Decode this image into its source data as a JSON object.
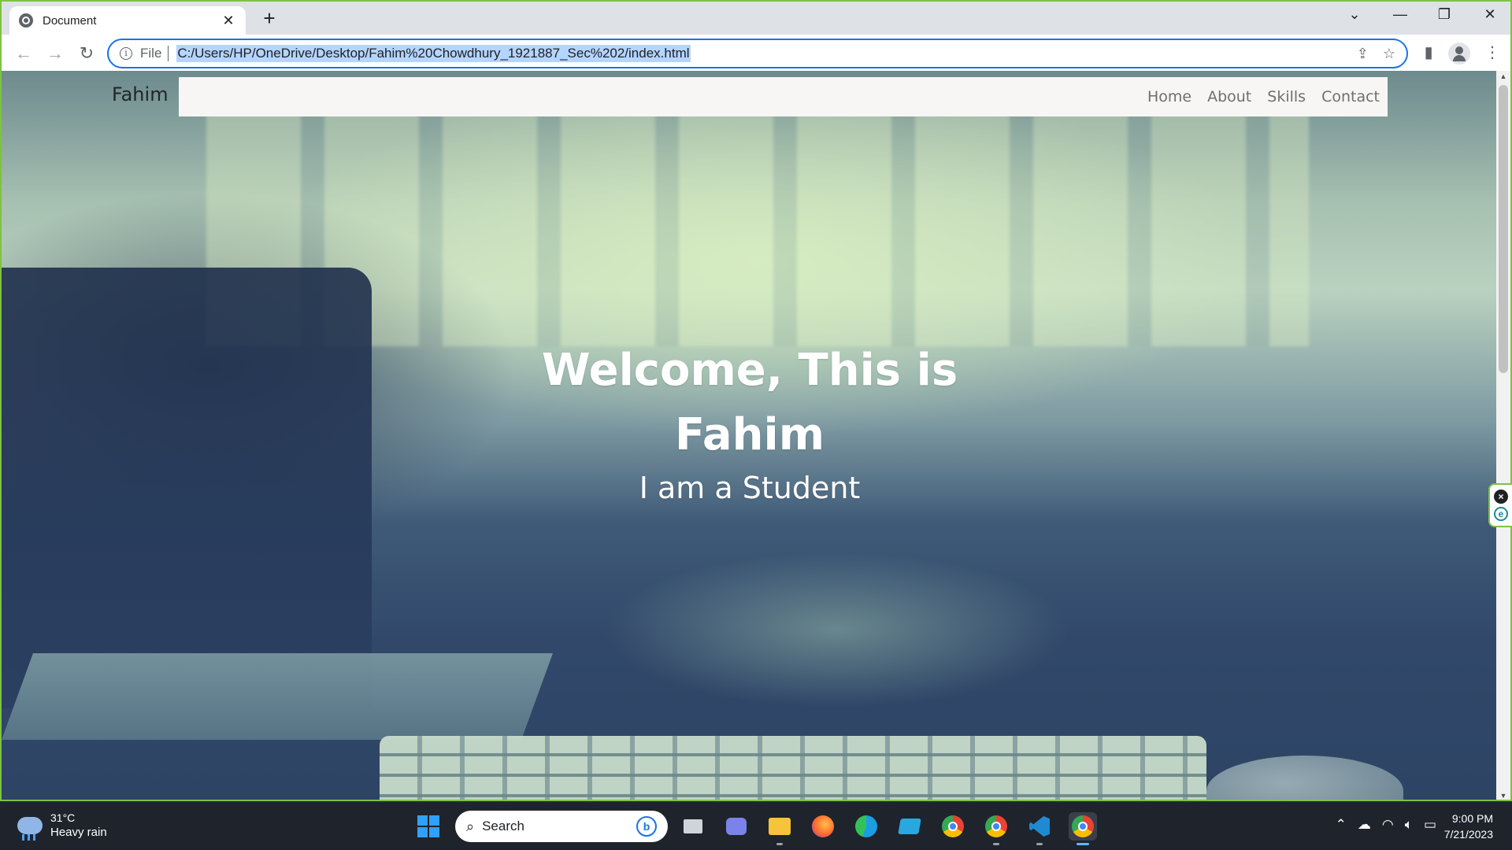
{
  "browser": {
    "tab_title": "Document",
    "tab_close": "✕",
    "new_tab": "+",
    "scheme_label": "File",
    "url": "C:/Users/HP/OneDrive/Desktop/Fahim%20Chowdhury_1921887_Sec%202/index.html",
    "window_controls": {
      "dropdown": "⌄",
      "minimize": "—",
      "restore": "❐",
      "close": "✕"
    },
    "icons": [
      "back-icon",
      "forward-icon",
      "reload-icon",
      "info-icon",
      "share-icon",
      "star-icon",
      "sidepanel-icon",
      "profile-icon",
      "menu-icon"
    ]
  },
  "site": {
    "brand": "Fahim",
    "nav": [
      "Home",
      "About",
      "Skills",
      "Contact"
    ],
    "hero_title": "Welcome, This is Fahim",
    "hero_subtitle": "I am a Student"
  },
  "taskbar": {
    "weather_temp": "31°C",
    "weather_condition": "Heavy rain",
    "search_label": "Search",
    "time": "9:00 PM",
    "date": "7/21/2023",
    "apps": [
      "task-view",
      "teams",
      "file-explorer",
      "firefox",
      "edge",
      "store",
      "chrome",
      "chrome",
      "vscode",
      "chrome"
    ]
  },
  "colors": {
    "accent": "#1a73e8",
    "window_border": "#7ec242",
    "navbar_bg": "#f8f6f4",
    "taskbar_bg": "#1f232b"
  }
}
